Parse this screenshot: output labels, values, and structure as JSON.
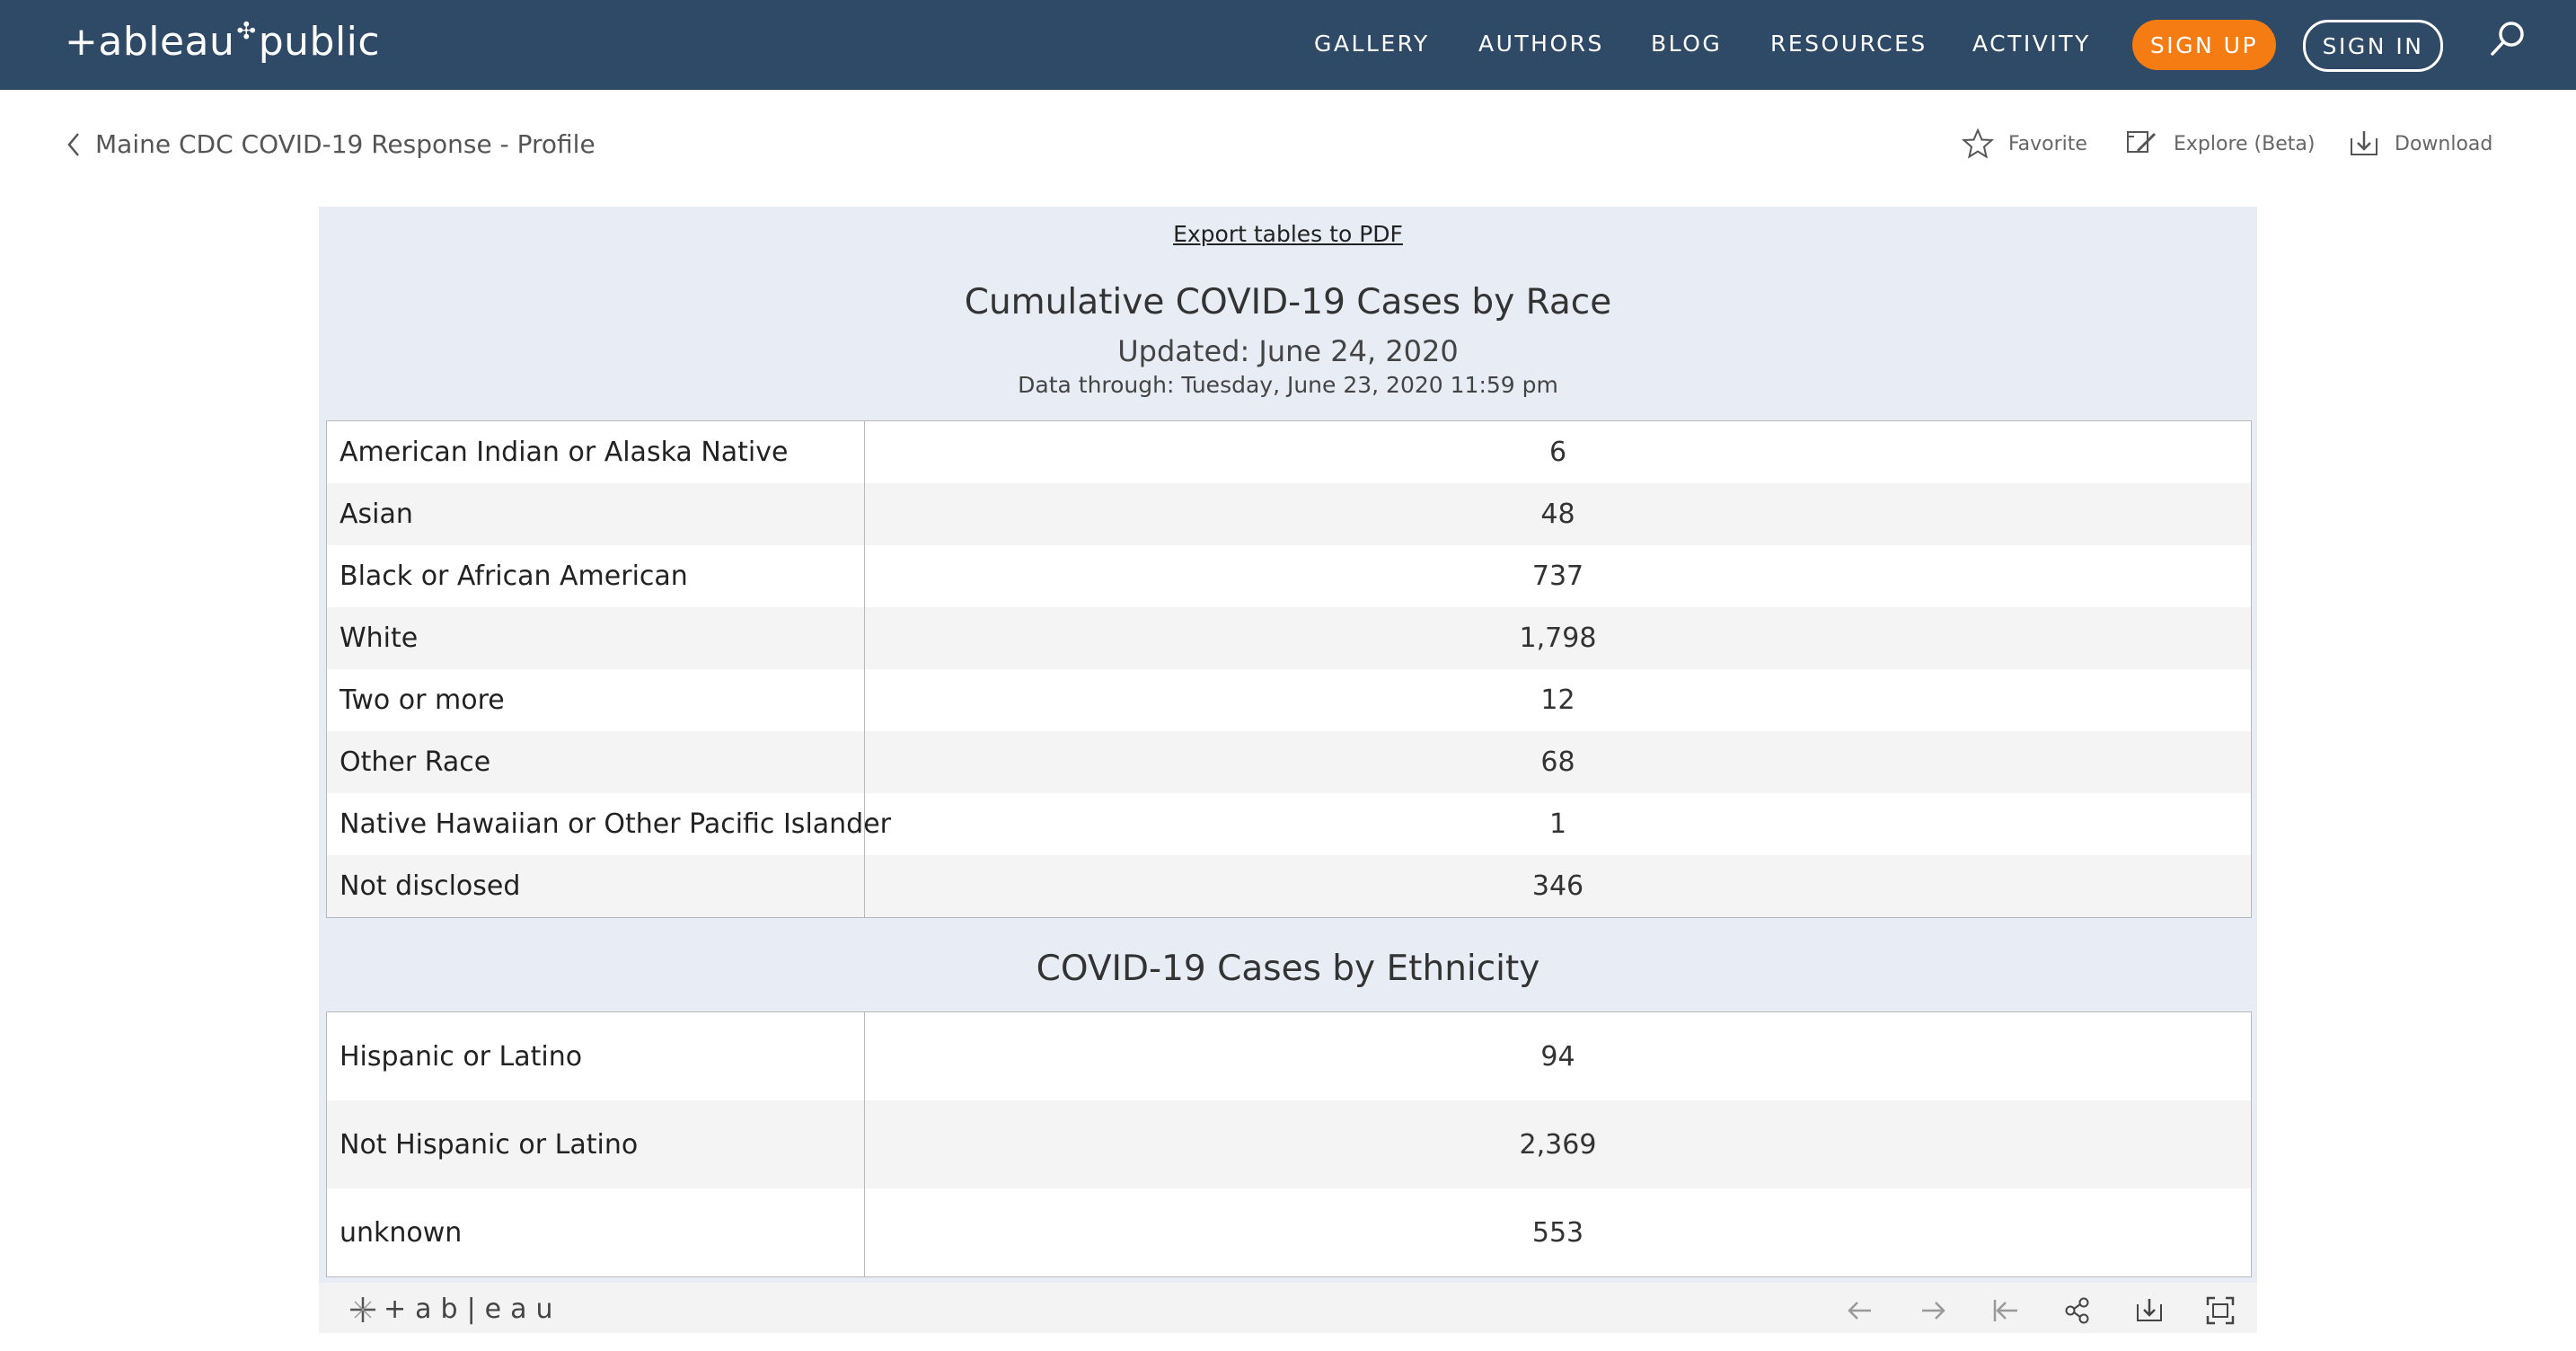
{
  "nav": {
    "logo_left": "+ableau",
    "logo_right": "public",
    "links": [
      "GALLERY",
      "AUTHORS",
      "BLOG",
      "RESOURCES",
      "ACTIVITY"
    ],
    "signup": "SIGN UP",
    "signin": "SIGN IN"
  },
  "subheader": {
    "back_label": "Maine CDC COVID-19 Response - Profile",
    "favorite": "Favorite",
    "explore": "Explore (Beta)",
    "download": "Download"
  },
  "viz": {
    "export_link": "Export tables to PDF",
    "race": {
      "title": "Cumulative COVID-19 Cases by Race",
      "updated": "Updated: June 24, 2020",
      "data_through": "Data through: Tuesday, June 23, 2020 11:59 pm",
      "rows": [
        {
          "label": "American Indian or Alaska Native",
          "value": "6"
        },
        {
          "label": "Asian",
          "value": "48"
        },
        {
          "label": "Black or African American",
          "value": "737"
        },
        {
          "label": "White",
          "value": "1,798"
        },
        {
          "label": "Two or more",
          "value": "12"
        },
        {
          "label": "Other Race",
          "value": "68"
        },
        {
          "label": "Native Hawaiian or Other Pacific Islander",
          "value": "1"
        },
        {
          "label": "Not disclosed",
          "value": "346"
        }
      ]
    },
    "ethnicity": {
      "title": "COVID-19 Cases by Ethnicity",
      "rows": [
        {
          "label": "Hispanic or Latino",
          "value": "94"
        },
        {
          "label": "Not Hispanic or Latino",
          "value": "2,369"
        },
        {
          "label": "unknown",
          "value": "553"
        }
      ]
    },
    "toolbar_logo": "+ab|eau"
  }
}
